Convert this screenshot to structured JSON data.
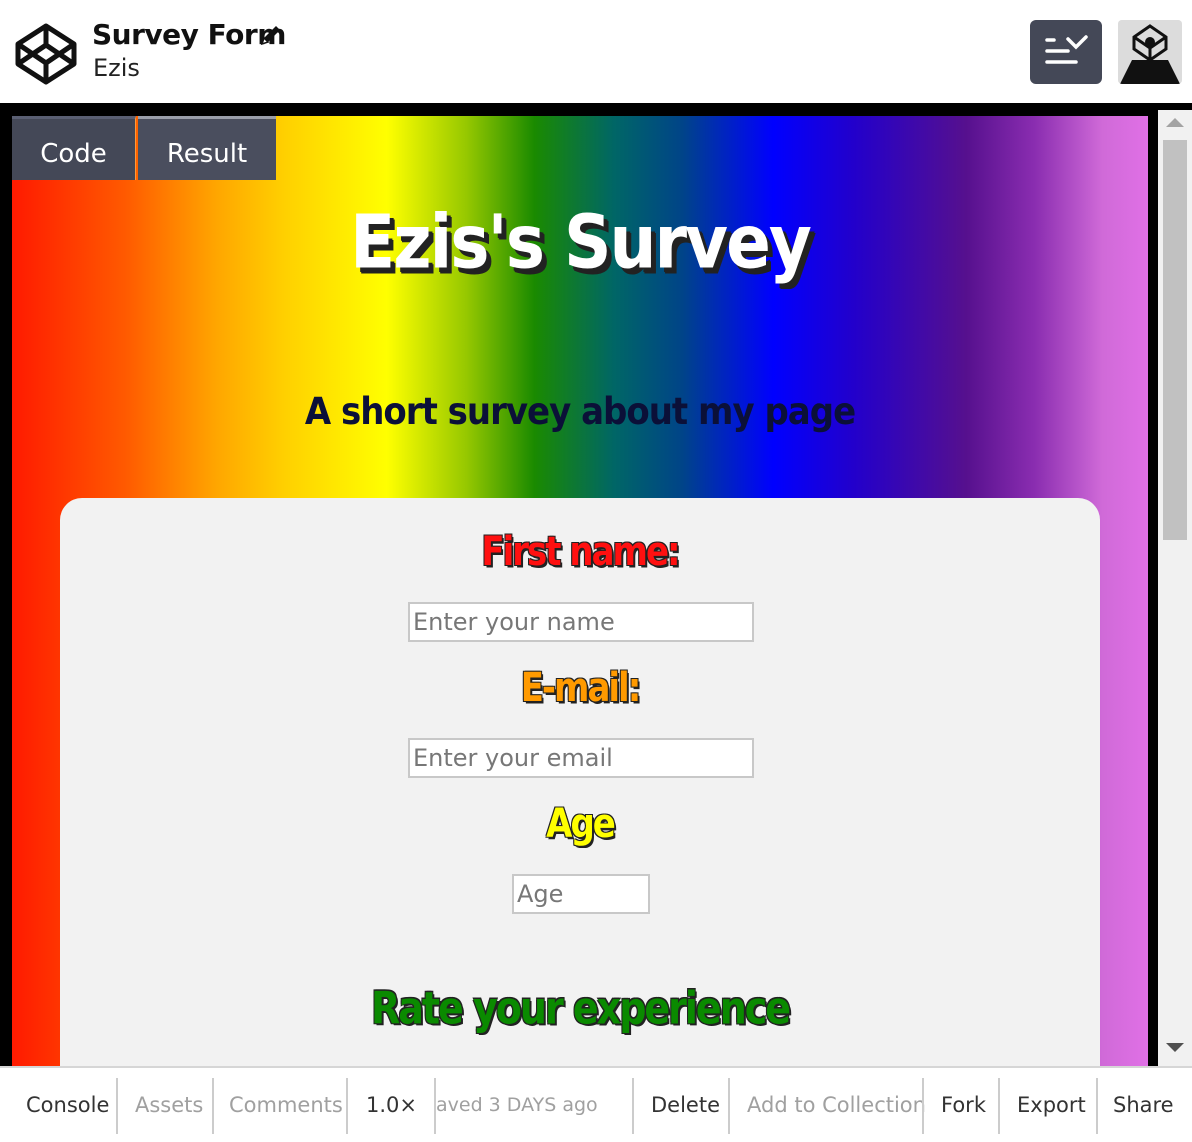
{
  "header": {
    "title": "Survey Form",
    "author": "Ezis"
  },
  "editor_tabs": {
    "code_label": "Code",
    "result_label": "Result"
  },
  "preview": {
    "survey_title": "Ezis's Survey",
    "survey_subtitle": "A short survey about my page",
    "first_name_label": "First name:",
    "first_name_placeholder": "Enter your name",
    "email_label": "E-mail:",
    "email_placeholder": "Enter your email",
    "age_label": "Age",
    "age_placeholder": "Age",
    "rate_label": "Rate your experience"
  },
  "bottombar": {
    "console": "Console",
    "assets": "Assets",
    "comments": "Comments",
    "zoom": "1.0×",
    "saved_status": "aved 3 DAYS ago",
    "delete": "Delete",
    "add_to_collection": "Add to Collection",
    "fork": "Fork",
    "export": "Export",
    "share": "Share"
  },
  "colors": {
    "toolbar_button": "#444857",
    "card_bg": "#f2f2f2",
    "first_name_color": "#ff1010",
    "email_color": "#ff9a00",
    "age_color": "#ffff00",
    "rate_color": "#0a8a00"
  }
}
